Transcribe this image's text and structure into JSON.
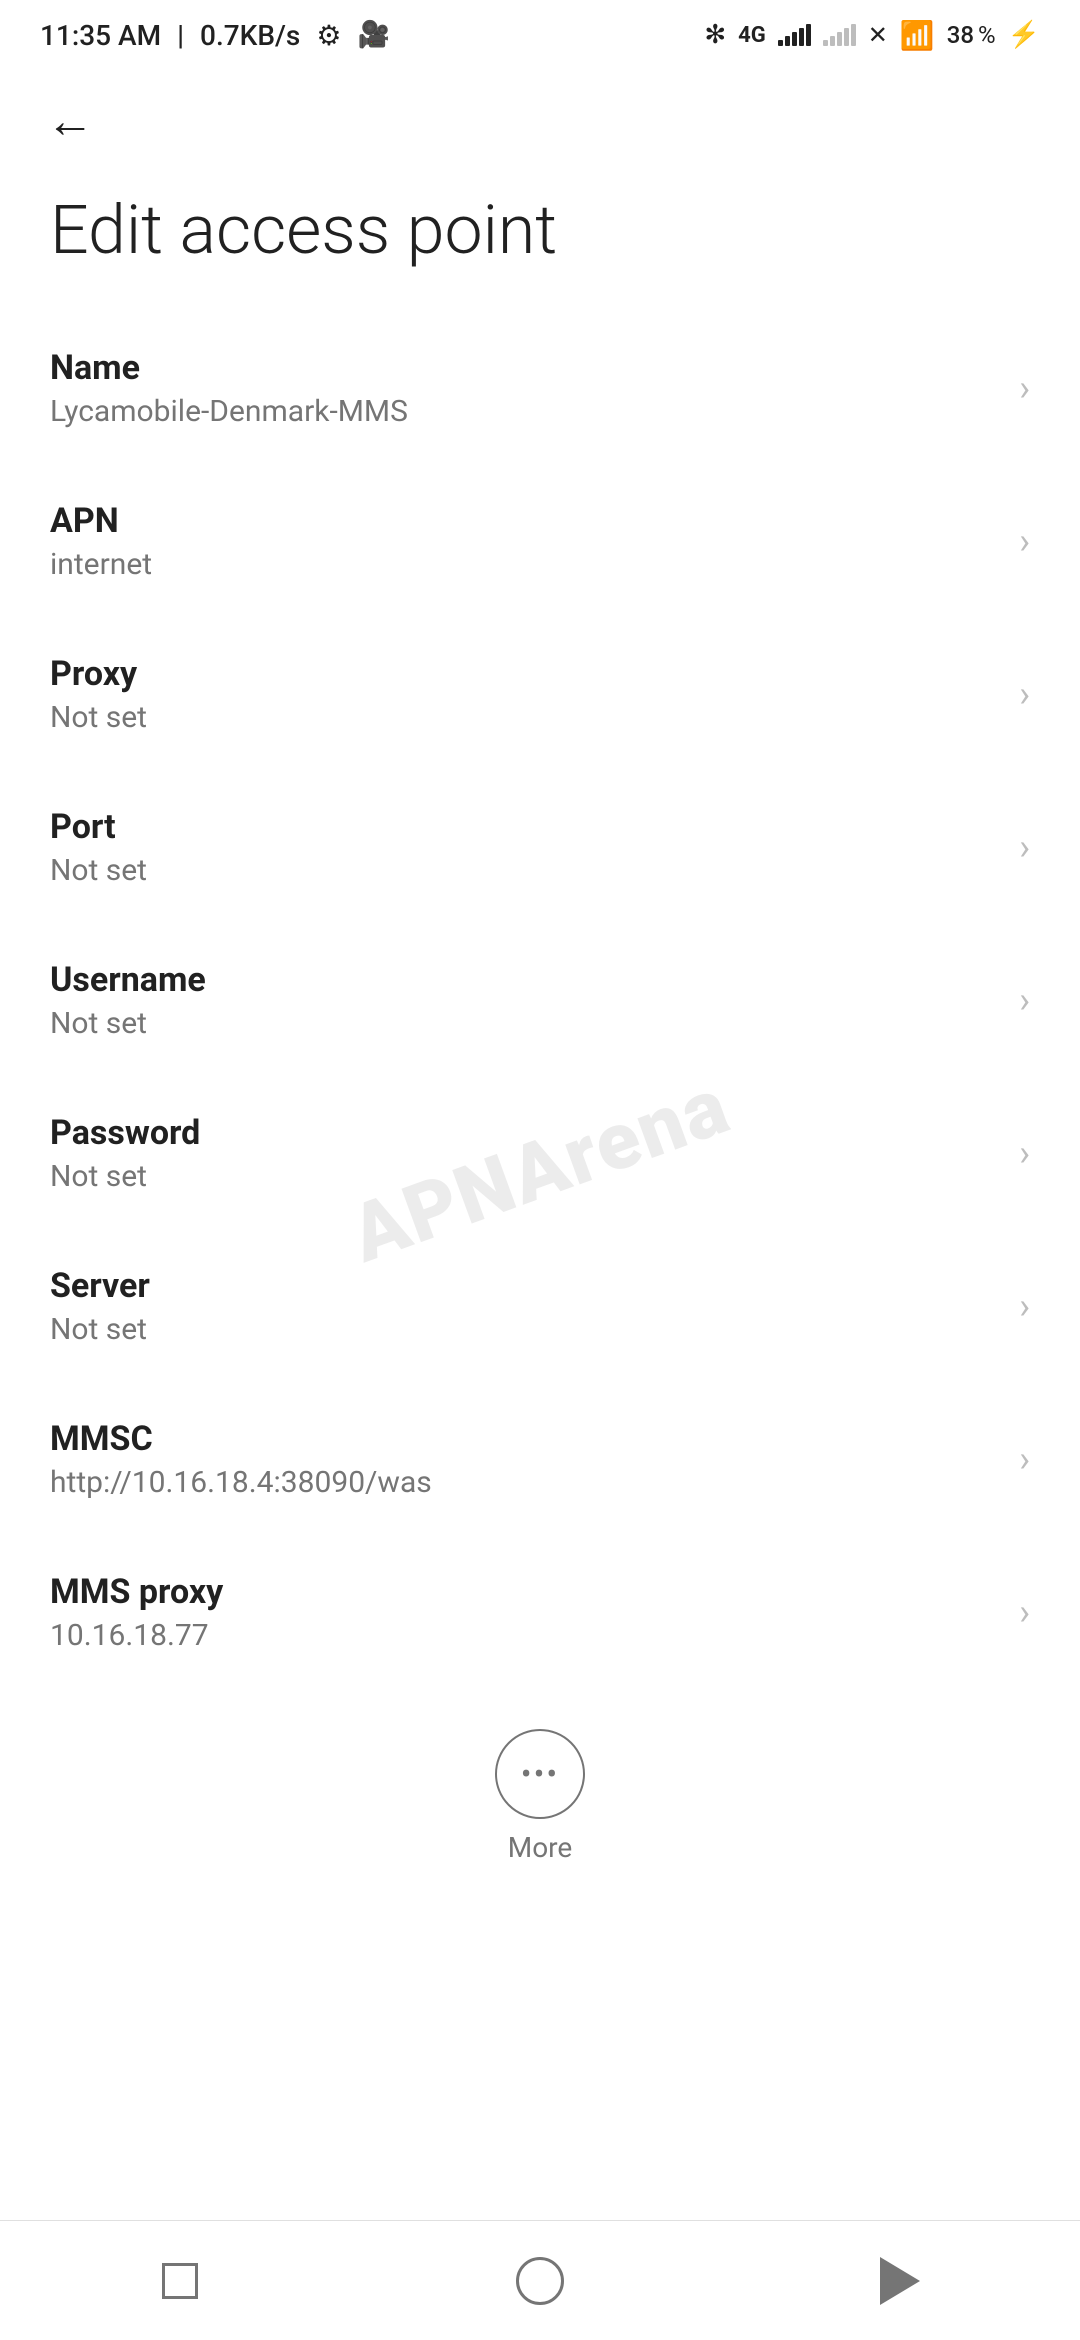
{
  "statusBar": {
    "time": "11:35 AM",
    "speed": "0.7KB/s",
    "battery_level": 38
  },
  "navigation": {
    "back_button_label": "←"
  },
  "page": {
    "title": "Edit access point"
  },
  "settings": {
    "items": [
      {
        "label": "Name",
        "value": "Lycamobile-Denmark-MMS"
      },
      {
        "label": "APN",
        "value": "internet"
      },
      {
        "label": "Proxy",
        "value": "Not set"
      },
      {
        "label": "Port",
        "value": "Not set"
      },
      {
        "label": "Username",
        "value": "Not set"
      },
      {
        "label": "Password",
        "value": "Not set"
      },
      {
        "label": "Server",
        "value": "Not set"
      },
      {
        "label": "MMSC",
        "value": "http://10.16.18.4:38090/was"
      },
      {
        "label": "MMS proxy",
        "value": "10.16.18.77"
      }
    ]
  },
  "more_button": {
    "label": "More"
  },
  "bottomNav": {
    "square_label": "recent",
    "circle_label": "home",
    "triangle_label": "back"
  },
  "watermark": {
    "text": "APNArena"
  }
}
